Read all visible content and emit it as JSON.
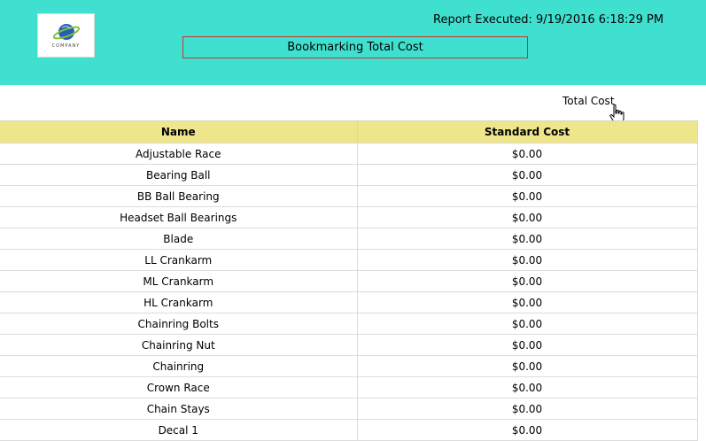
{
  "header": {
    "logo_text": "COMPANY",
    "report_executed": "Report Executed: 9/19/2016 6:18:29 PM",
    "title": "Bookmarking Total Cost",
    "background_color": "#40e0d0"
  },
  "total_cost_link": "Total Cost",
  "cursor_icon": "hand-pointer-icon",
  "table": {
    "columns": [
      "Name",
      "Standard Cost"
    ],
    "header_color": "#efe68c",
    "rows": [
      [
        "Adjustable Race",
        "$0.00"
      ],
      [
        "Bearing Ball",
        "$0.00"
      ],
      [
        "BB Ball Bearing",
        "$0.00"
      ],
      [
        "Headset Ball Bearings",
        "$0.00"
      ],
      [
        "Blade",
        "$0.00"
      ],
      [
        "LL Crankarm",
        "$0.00"
      ],
      [
        "ML Crankarm",
        "$0.00"
      ],
      [
        "HL Crankarm",
        "$0.00"
      ],
      [
        "Chainring Bolts",
        "$0.00"
      ],
      [
        "Chainring Nut",
        "$0.00"
      ],
      [
        "Chainring",
        "$0.00"
      ],
      [
        "Crown Race",
        "$0.00"
      ],
      [
        "Chain Stays",
        "$0.00"
      ],
      [
        "Decal 1",
        "$0.00"
      ]
    ]
  }
}
